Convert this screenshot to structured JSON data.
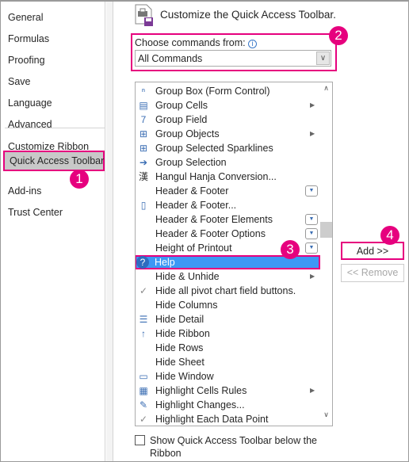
{
  "sidebar": {
    "items": [
      {
        "label": "General"
      },
      {
        "label": "Formulas"
      },
      {
        "label": "Proofing"
      },
      {
        "label": "Save"
      },
      {
        "label": "Language"
      },
      {
        "label": "Advanced"
      },
      {
        "label": "Customize Ribbon"
      },
      {
        "label": "Quick Access Toolbar",
        "selected": true
      },
      {
        "label": "Add-ins"
      },
      {
        "label": "Trust Center"
      }
    ]
  },
  "header": {
    "title": "Customize the Quick Access Toolbar."
  },
  "commands": {
    "label": "Choose commands from:",
    "selected": "All Commands",
    "items": [
      {
        "label": "Group Box (Form Control)",
        "icon": "xyz"
      },
      {
        "label": "Group Cells",
        "icon": "group-cells",
        "submenu": true
      },
      {
        "label": "Group Field",
        "icon": "7"
      },
      {
        "label": "Group Objects",
        "icon": "group-objects",
        "submenu": true
      },
      {
        "label": "Group Selected Sparklines",
        "icon": "group-objects"
      },
      {
        "label": "Group Selection",
        "icon": "arrow-right"
      },
      {
        "label": "Hangul Hanja Conversion...",
        "icon": "漢"
      },
      {
        "label": "Header & Footer",
        "dropdown": true
      },
      {
        "label": "Header & Footer...",
        "icon": "page"
      },
      {
        "label": "Header & Footer Elements",
        "dropdown": true
      },
      {
        "label": "Header & Footer Options",
        "dropdown": true
      },
      {
        "label": "Height of Printout",
        "dropdown": true
      },
      {
        "label": "Help",
        "icon": "?",
        "selected": true
      },
      {
        "label": "Hide & Unhide",
        "submenu": true
      },
      {
        "label": "Hide all pivot chart field buttons.",
        "icon": "✓"
      },
      {
        "label": "Hide Columns"
      },
      {
        "label": "Hide Detail",
        "icon": "hide-detail"
      },
      {
        "label": "Hide Ribbon",
        "icon": "hide-ribbon"
      },
      {
        "label": "Hide Rows"
      },
      {
        "label": "Hide Sheet"
      },
      {
        "label": "Hide Window",
        "icon": "window"
      },
      {
        "label": "Highlight Cells Rules",
        "icon": "highlight",
        "submenu": true
      },
      {
        "label": "Highlight Changes...",
        "icon": "pen"
      },
      {
        "label": "Highlight Each Data Point",
        "icon": "✓"
      }
    ]
  },
  "buttons": {
    "add": "Add >>",
    "remove": "<< Remove"
  },
  "checkbox": {
    "label": "Show Quick Access Toolbar below the Ribbon",
    "checked": false
  },
  "badges": [
    "1",
    "2",
    "3",
    "4"
  ],
  "colors": {
    "accent": "#e6007e",
    "selection": "#3c98f5"
  }
}
